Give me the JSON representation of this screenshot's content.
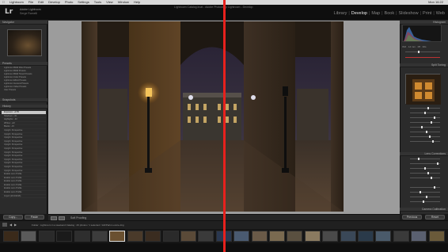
{
  "menubar": {
    "items": [
      "Lightroom",
      "File",
      "Edit",
      "Develop",
      "Photo",
      "Settings",
      "Tools",
      "View",
      "Window",
      "Help"
    ],
    "clock": "Mon 16:22"
  },
  "window": {
    "title": "Lightroom Catalog.lrcat - Adobe Photoshop Lightroom - Develop"
  },
  "identity": {
    "logo": "Lr",
    "line1": "Adobe Lightroom",
    "line2": "Serge Ramelli"
  },
  "modules": {
    "items": [
      "Library",
      "Develop",
      "Map",
      "Book",
      "Slideshow",
      "Print",
      "Web"
    ],
    "active": "Develop"
  },
  "left": {
    "navigator_title": "Navigator",
    "presets_title": "Presets",
    "presets": [
      "Lightroom B&W Filter Presets",
      "Lightroom B&W Presets",
      "Lightroom B&W Toned Presets",
      "Lightroom Color Presets",
      "Lightroom Effect Presets",
      "Lightroom General Presets",
      "Lightroom Video Presets",
      "User Presets"
    ],
    "snapshots_title": "Snapshots",
    "history_title": "History",
    "history": [
      "Exposure: +0.55",
      "Shadows: +51",
      "Highlights: -43",
      "Whites: +22",
      "Blacks: -15",
      "Upright: Perspective",
      "Upright: Perspective",
      "Upright: Perspective",
      "Upright: Perspective",
      "Upright: Perspective",
      "Upright: Perspective",
      "Upright: Perspective",
      "Upright: Perspective",
      "Upright: Perspective",
      "Upright: Perspective",
      "Upright: Perspective",
      "Upright: Perspective",
      "Enable Lens Profile",
      "Enable Lens Profile",
      "Enable Lens Profile",
      "Enable Lens Profile",
      "Enable Lens Profile",
      "Enable Lens Profile",
      "Import (2/13/2016)"
    ],
    "copy_label": "Copy...",
    "paste_label": "Paste"
  },
  "toolbar": {
    "softproof_label": "Soft Proofing"
  },
  "right": {
    "histogram_title": "Histogram",
    "split_toning_title": "Split Toning",
    "lens_title": "Lens Corrections",
    "camera_calibration_title": "Camera Calibration",
    "previous_label": "Previous",
    "reset_label": "Reset"
  },
  "filmstrip": {
    "path": "Folder : Lightroom in a weekend Catalog : 26 photos / 1 selected / 1AFParis Louvre.dng",
    "thumb_count": 25,
    "selected_index": 6
  },
  "colors": {
    "split_line": "#e8211d",
    "viewer_bg": "#9c9c9c"
  }
}
